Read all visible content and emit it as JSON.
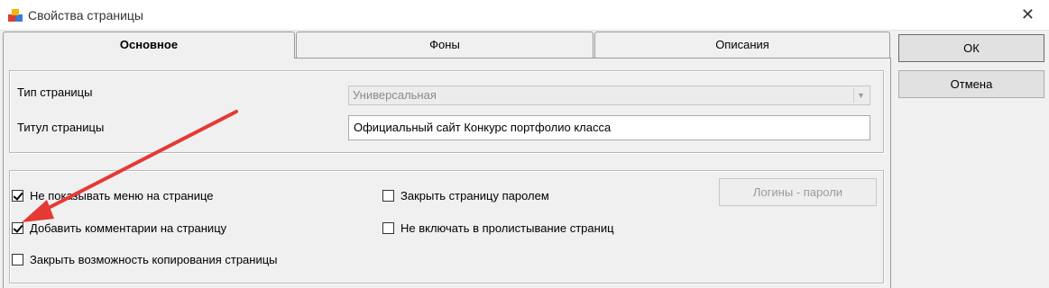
{
  "window": {
    "title": "Свойства страницы",
    "close_glyph": "✕",
    "app_icon": "puzzle-icon"
  },
  "tabs": [
    {
      "label": "Основное",
      "active": true
    },
    {
      "label": "Фоны",
      "active": false
    },
    {
      "label": "Описания",
      "active": false
    }
  ],
  "general": {
    "page_type_label": "Тип страницы",
    "page_type_value": "Универсальная",
    "page_title_label": "Титул страницы",
    "page_title_value": "Официальный сайт Конкурс портфолио класса"
  },
  "options": {
    "hide_menu": {
      "label": "Не показывать меню на странице",
      "checked": true
    },
    "add_comments": {
      "label": "Добавить комментарии на страницу",
      "checked": true
    },
    "disable_copy": {
      "label": "Закрыть возможность копирования страницы",
      "checked": false
    },
    "password_protect": {
      "label": "Закрыть страницу паролем",
      "checked": false
    },
    "exclude_paging": {
      "label": "Не включать в пролистывание страниц",
      "checked": false
    },
    "logins_button": "Логины - пароли"
  },
  "buttons": {
    "ok": "ОК",
    "cancel": "Отмена"
  },
  "annotation": {
    "arrow_color": "#e53935"
  }
}
